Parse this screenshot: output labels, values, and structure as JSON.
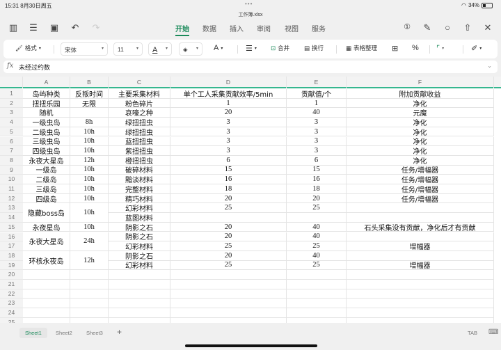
{
  "status": {
    "time": "15:31  8月30日周五",
    "battery": "34%"
  },
  "window_title": "工作簿.xlsx",
  "menu_tabs": [
    "开始",
    "数据",
    "插入",
    "审阅",
    "视图",
    "服务"
  ],
  "active_tab": "开始",
  "toolbar": {
    "format": "格式",
    "font": "宋体",
    "size": "11",
    "merge": "合并",
    "wrap": "换行",
    "table_tidy": "表格整理",
    "percent": "%"
  },
  "formula": {
    "fx": "fx",
    "value": "未经过约数"
  },
  "columns": [
    "A",
    "B",
    "C",
    "D",
    "E",
    "F"
  ],
  "rows": [
    {
      "n": "1",
      "cells": [
        "岛屿种类",
        "反叛时间",
        "主要采集材料",
        "单个工人采集贡献效率/5min",
        "贡献值/个",
        "附加贡献收益"
      ]
    },
    {
      "n": "2",
      "cells": [
        "扭扭乐园",
        "无限",
        "粉色碎片",
        "1",
        "1",
        "净化"
      ]
    },
    {
      "n": "3",
      "cells": [
        "随机",
        "",
        "哀嚎之种",
        "20",
        "40",
        "元魔"
      ]
    },
    {
      "n": "4",
      "cells": [
        "一级虫岛",
        "8h",
        "绿扭扭虫",
        "3",
        "3",
        "净化"
      ]
    },
    {
      "n": "5",
      "cells": [
        "二级虫岛",
        "10h",
        "绿扭扭虫",
        "3",
        "3",
        "净化"
      ]
    },
    {
      "n": "6",
      "cells": [
        "三级虫岛",
        "10h",
        "蓝扭扭虫",
        "3",
        "3",
        "净化"
      ]
    },
    {
      "n": "7",
      "cells": [
        "四级虫岛",
        "10h",
        "紫扭扭虫",
        "3",
        "3",
        "净化"
      ]
    },
    {
      "n": "8",
      "cells": [
        "永夜大星岛",
        "12h",
        "橙扭扭虫",
        "6",
        "6",
        "净化"
      ]
    },
    {
      "n": "9",
      "cells": [
        "一级岛",
        "10h",
        "破碎材料",
        "15",
        "15",
        "任务/增幅器"
      ]
    },
    {
      "n": "10",
      "cells": [
        "二级岛",
        "10h",
        "黯淡材料",
        "16",
        "16",
        "任务/增幅器"
      ]
    },
    {
      "n": "11",
      "cells": [
        "三级岛",
        "10h",
        "完整材料",
        "18",
        "18",
        "任务/增幅器"
      ]
    },
    {
      "n": "12",
      "cells": [
        "四级岛",
        "10h",
        "精巧材料",
        "20",
        "20",
        "任务/增幅器"
      ]
    },
    {
      "n": "13",
      "cells": [
        "隐藏boss岛",
        "10h",
        "幻彩材料",
        "25",
        "25",
        ""
      ],
      "merge_ab": 2
    },
    {
      "n": "14",
      "cells": [
        null,
        null,
        "蓝图材料",
        "",
        "",
        ""
      ]
    },
    {
      "n": "15",
      "cells": [
        "永夜星岛",
        "10h",
        "阴影之石",
        "20",
        "40",
        "石头采集没有贡献，净化后才有贡献"
      ]
    },
    {
      "n": "16",
      "cells": [
        "永夜大星岛",
        "24h",
        "阴影之石",
        "20",
        "40",
        ""
      ],
      "merge_ab": 2
    },
    {
      "n": "17",
      "cells": [
        null,
        null,
        "幻彩材料",
        "25",
        "25",
        "增幅器"
      ]
    },
    {
      "n": "18",
      "cells": [
        "环核永夜岛",
        "12h",
        "阴影之石",
        "20",
        "40",
        ""
      ],
      "merge_ab": 2
    },
    {
      "n": "19",
      "cells": [
        null,
        null,
        "幻彩材料",
        "25",
        "25",
        "增幅器"
      ]
    },
    {
      "n": "20",
      "cells": [
        "",
        "",
        "",
        "",
        "",
        ""
      ]
    },
    {
      "n": "21",
      "cells": [
        "",
        "",
        "",
        "",
        "",
        ""
      ]
    },
    {
      "n": "22",
      "cells": [
        "",
        "",
        "",
        "",
        "",
        ""
      ]
    },
    {
      "n": "23",
      "cells": [
        "",
        "",
        "",
        "",
        "",
        ""
      ]
    },
    {
      "n": "24",
      "cells": [
        "",
        "",
        "",
        "",
        "",
        ""
      ]
    },
    {
      "n": "25",
      "cells": [
        "",
        "",
        "",
        "",
        "",
        ""
      ]
    }
  ],
  "sheets": [
    "Sheet1",
    "Sheet2",
    "Sheet3"
  ],
  "active_sheet": "Sheet1",
  "add_sheet": "+",
  "tab_key": "TAB",
  "accent": "#1a8a5a"
}
